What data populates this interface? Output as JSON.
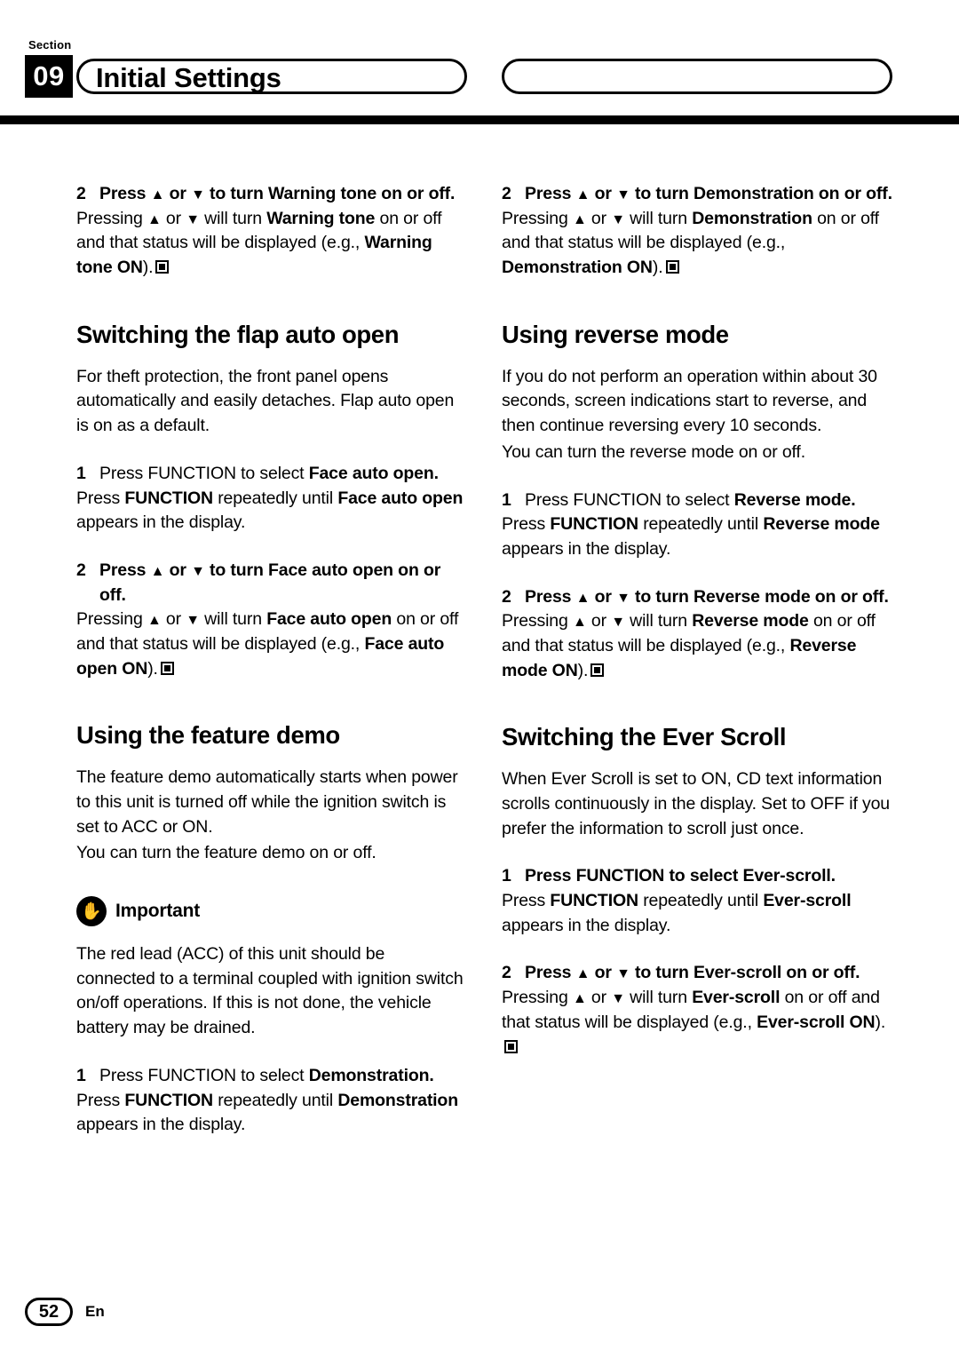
{
  "header": {
    "section_label": "Section",
    "section_number": "09",
    "title": "Initial Settings"
  },
  "footer": {
    "page_number": "52",
    "language": "En"
  },
  "icons": {
    "up_arrow": "▲",
    "down_arrow": "▼",
    "important": "✋"
  },
  "left_column": {
    "warning_tone_step": {
      "num": "2",
      "head_a": "Press ",
      "head_up": "▲",
      "head_or": " or ",
      "head_down": "▼",
      "head_b": " to turn Warning tone on or off."
    },
    "warning_tone_body": {
      "p1": "Pressing ",
      "up": "▲",
      "or": " or ",
      "down": "▼",
      "p2": " will turn ",
      "bold1": "Warning tone",
      "p3": " on or off and that status will be displayed (e.g., ",
      "bold2": "Warning tone ON",
      "p4": ")."
    },
    "flap_heading": "Switching the flap auto open",
    "flap_intro": "For theft protection, the front panel opens automatically and easily detaches. Flap auto open is on as a default.",
    "flap_step1": {
      "num": "1",
      "text_reg": "Press FUNCTION to select ",
      "text_bold": "Face auto open."
    },
    "flap_step1_body": {
      "p1": "Press ",
      "bold1": "FUNCTION",
      "p2": " repeatedly until ",
      "bold2": "Face auto open",
      "p3": " appears in the display."
    },
    "flap_step2": {
      "num": "2",
      "head_a": "Press ",
      "head_up": "▲",
      "head_or": " or ",
      "head_down": "▼",
      "head_b": " to turn Face auto open on or off."
    },
    "flap_step2_body": {
      "p1": "Pressing ",
      "up": "▲",
      "or": " or ",
      "down": "▼",
      "p2": " will turn ",
      "bold1": "Face auto open",
      "p3": " on or off and that status will be displayed (e.g., ",
      "bold2": "Face auto open ON",
      "p4": ")."
    },
    "demo_heading": "Using the feature demo",
    "demo_intro": "The feature demo automatically starts when power to this unit is turned off while the ignition switch is set to ACC or ON.",
    "demo_intro2": "You can turn the feature demo on or off.",
    "important_label": "Important",
    "important_body": "The red lead (ACC) of this unit should be connected to a terminal coupled with ignition switch on/off operations. If this is not done, the vehicle battery may be drained.",
    "demo_step1": {
      "num": "1",
      "text_reg": "Press FUNCTION to select ",
      "text_bold": "Demonstration."
    },
    "demo_step1_body": {
      "p1": "Press ",
      "bold1": "FUNCTION",
      "p2": " repeatedly until ",
      "bold2": "Demonstration",
      "p3": " appears in the display."
    }
  },
  "right_column": {
    "demo_step": {
      "num": "2",
      "head_a": "Press ",
      "head_up": "▲",
      "head_or": " or ",
      "head_down": "▼",
      "head_b": " to turn Demonstration on or off."
    },
    "demo_step_body": {
      "p1": "Pressing ",
      "up": "▲",
      "or": " or ",
      "down": "▼",
      "p2": " will turn ",
      "bold1": "Demonstration",
      "p3": " on or off and that status will be displayed (e.g., ",
      "bold2": "Demonstration ON",
      "p4": ")."
    },
    "reverse_heading": "Using reverse mode",
    "reverse_intro": "If you do not perform an operation within about 30 seconds, screen indications start to reverse, and then continue reversing every 10 seconds.",
    "reverse_intro2": "You can turn the reverse mode on or off.",
    "reverse_step1": {
      "num": "1",
      "text_reg": "Press FUNCTION to select ",
      "text_bold": "Reverse mode."
    },
    "reverse_step1_body": {
      "p1": "Press ",
      "bold1": "FUNCTION",
      "p2": " repeatedly until ",
      "bold2": "Reverse mode",
      "p3": " appears in the display."
    },
    "reverse_step2": {
      "num": "2",
      "head_a": "Press ",
      "head_up": "▲",
      "head_or": " or ",
      "head_down": "▼",
      "head_b": " to turn Reverse mode on or off."
    },
    "reverse_step2_body": {
      "p1": "Pressing ",
      "up": "▲",
      "or": " or ",
      "down": "▼",
      "p2": " will turn ",
      "bold1": "Reverse mode",
      "p3": " on or off and that status will be displayed (e.g., ",
      "bold2": "Reverse mode ON",
      "p4": ")."
    },
    "ever_heading": "Switching the Ever Scroll",
    "ever_intro": "When Ever Scroll is set to ON, CD text information scrolls continuously in the display. Set to OFF if you prefer the information to scroll just once.",
    "ever_step1": {
      "num": "1",
      "text_reg": "Press FUNCTION to select Ever-scroll."
    },
    "ever_step1_body": {
      "p1": "Press ",
      "bold1": "FUNCTION",
      "p2": " repeatedly until ",
      "bold2": "Ever-scroll",
      "p3": " appears in the display."
    },
    "ever_step2": {
      "num": "2",
      "head_a": "Press ",
      "head_up": "▲",
      "head_or": " or ",
      "head_down": "▼",
      "head_b": " to turn Ever-scroll on or off."
    },
    "ever_step2_body": {
      "p1": "Pressing ",
      "up": "▲",
      "or": " or ",
      "down": "▼",
      "p2": " will turn ",
      "bold1": "Ever-scroll",
      "p3": " on or off and that status will be displayed (e.g., ",
      "bold2": "Ever-scroll ON",
      "p4": ")."
    }
  }
}
